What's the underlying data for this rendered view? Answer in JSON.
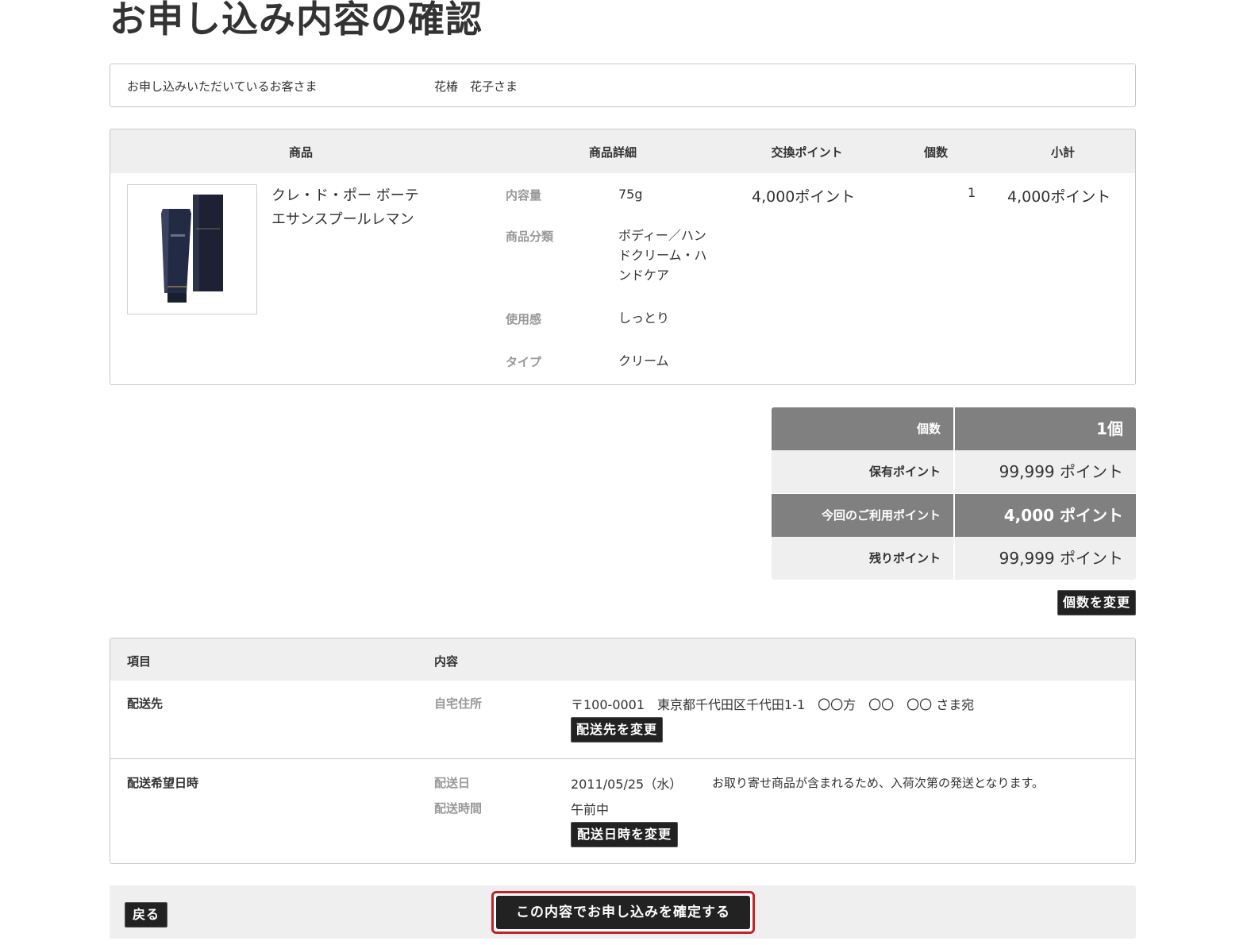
{
  "page_title": "お申し込み内容の確認",
  "customer": {
    "label": "お申し込みいただいているお客さま",
    "name": "花椿　花子さま"
  },
  "product_table": {
    "headers": {
      "product": "商品",
      "detail": "商品詳細",
      "points": "交換ポイント",
      "qty": "個数",
      "subtotal": "小計"
    },
    "item": {
      "name_line1": "クレ・ド・ポー ボーテ",
      "name_line2": "エサンスプールレマン",
      "details": [
        {
          "label": "内容量",
          "value": "75g"
        },
        {
          "label": "商品分類",
          "value_line1": "ボディー／ハン",
          "value_line2": "ドクリーム・ハ",
          "value_line3": "ンドケア"
        },
        {
          "label": "使用感",
          "value": "しっとり"
        },
        {
          "label": "タイプ",
          "value": "クリーム"
        }
      ],
      "points": "4,000ポイント",
      "qty": "1",
      "subtotal": "4,000ポイント"
    }
  },
  "summary": {
    "rows": [
      {
        "label": "個数",
        "value": "1個"
      },
      {
        "label": "保有ポイント",
        "value": "99,999 ポイント"
      },
      {
        "label": "今回のご利用ポイント",
        "value": "4,000 ポイント"
      },
      {
        "label": "残りポイント",
        "value": "99,999 ポイント"
      }
    ],
    "change_qty_button": "個数を変更"
  },
  "delivery_table": {
    "headers": {
      "item": "項目",
      "content": "内容"
    },
    "address": {
      "item": "配送先",
      "sublabel": "自宅住所",
      "text": "〒100-0001　東京都千代田区千代田1-1　〇〇方　〇〇　〇〇 さま宛",
      "button": "配送先を変更"
    },
    "datetime": {
      "item": "配送希望日時",
      "date_label": "配送日",
      "date_value": "2011/05/25（水）",
      "note": "お取り寄せ商品が含まれるため、入荷次第の発送となります。",
      "time_label": "配送時間",
      "time_value": "午前中",
      "button": "配送日時を変更"
    }
  },
  "footer": {
    "back_button": "戻る",
    "confirm_button": "この内容でお申し込みを確定する"
  },
  "colors": {
    "dark_button": "#222222",
    "header_gray": "#efefef",
    "summary_dark": "#808080",
    "confirm_outline": "#c0232b",
    "muted_label": "#999999"
  }
}
